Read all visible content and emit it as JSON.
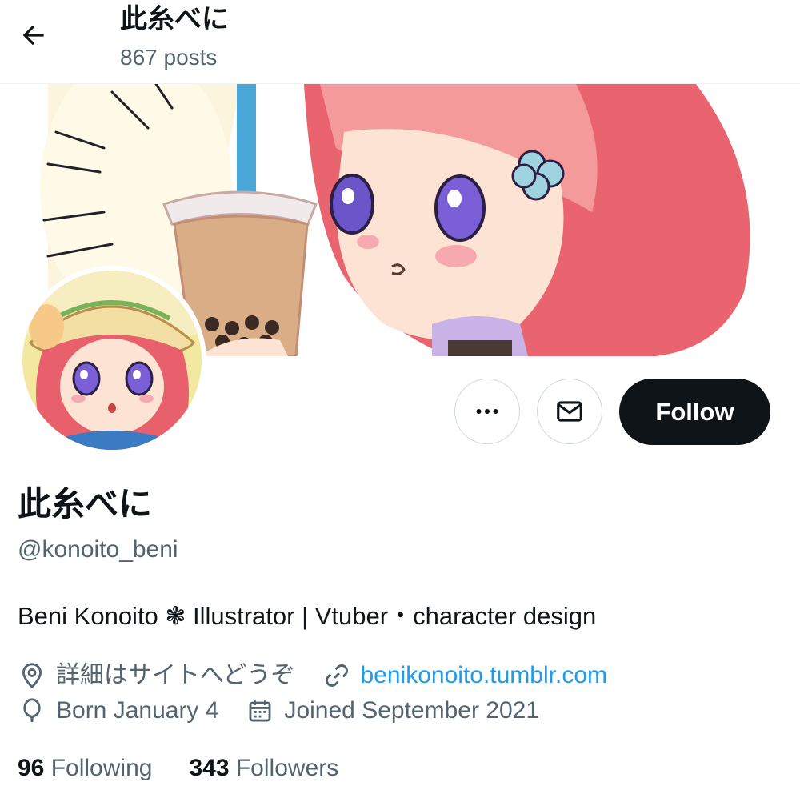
{
  "header": {
    "title": "此糸べに",
    "posts_count": "867 posts"
  },
  "icons": {
    "back": "arrow-left-icon",
    "more": "more-horizontal-icon",
    "message": "envelope-icon",
    "location": "location-pin-icon",
    "link": "link-icon",
    "birthday": "balloon-icon",
    "joined": "calendar-icon"
  },
  "actions": {
    "follow_label": "Follow"
  },
  "profile": {
    "display_name": "此糸べに",
    "handle": "@konoito_beni",
    "bio": "Beni Konoito ❃ Illustrator | Vtuber・character design",
    "location": "詳細はサイトへどうぞ",
    "website": "benikonoito.tumblr.com",
    "birthday": "Born January 4",
    "joined": "Joined September 2021"
  },
  "stats": {
    "following_count": "96",
    "following_label": "Following",
    "followers_count": "343",
    "followers_label": "Followers"
  },
  "colors": {
    "accent": "#1d9bf0",
    "text": "#0f1419",
    "secondary": "#536471",
    "follow_bg": "#0f1419"
  }
}
